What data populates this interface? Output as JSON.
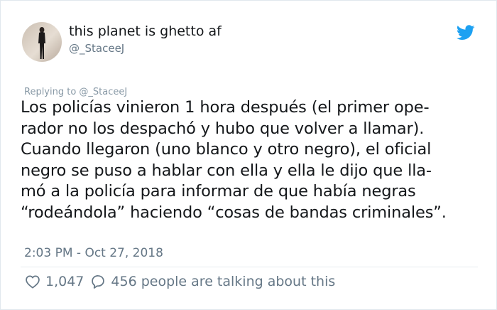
{
  "user": {
    "display_name": "this planet is ghetto af",
    "handle": "@_StaceeJ"
  },
  "tweet": {
    "replying_to": "Replying to @_StaceeJ",
    "lines": [
      "Los policías vinieron 1 hora después (el primer ope-",
      "rador no los despachó y hubo que volver a llamar).",
      "Cuando llegaron (uno blanco y otro negro), el oficial",
      "negro se puso a hablar con ella y ella le dijo que lla-",
      "mó a la policía para informar de que había negras",
      "“rodeándola” haciendo “cosas de bandas criminales”."
    ],
    "timestamp": "2:03 PM - Oct 27, 2018"
  },
  "engagement": {
    "likes": "1,047",
    "talking": "456 people are talking about this"
  },
  "icons": {
    "brand": "twitter-bird-icon",
    "like": "heart-icon",
    "reply": "speech-bubble-icon"
  },
  "colors": {
    "twitter_blue": "#1da1f2",
    "secondary_text": "#657786",
    "primary_text": "#14171a"
  }
}
